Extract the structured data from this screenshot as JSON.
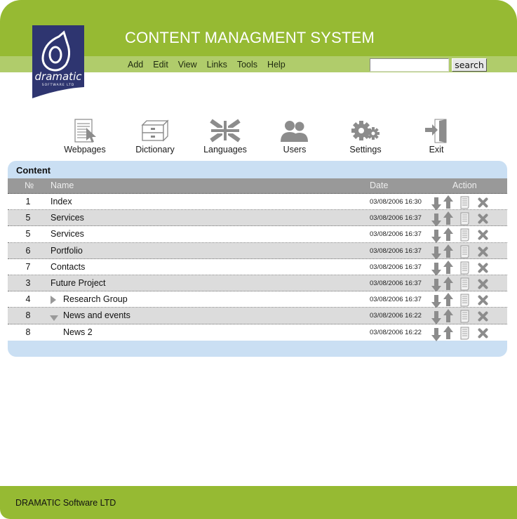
{
  "header": {
    "title": "CONTENT MANAGMENT SYSTEM",
    "logo": {
      "name": "dramatic",
      "tagline": "SOFTWARE LTD"
    },
    "menu": [
      "Add",
      "Edit",
      "View",
      "Links",
      "Tools",
      "Help"
    ],
    "search": {
      "value": "",
      "placeholder": "",
      "button_label": "search"
    }
  },
  "toolbar": [
    {
      "label": "Webpages",
      "icon": "webpage-icon"
    },
    {
      "label": "Dictionary",
      "icon": "dictionary-icon"
    },
    {
      "label": "Languages",
      "icon": "uk-flag-icon"
    },
    {
      "label": "Users",
      "icon": "users-icon"
    },
    {
      "label": "Settings",
      "icon": "gears-icon"
    },
    {
      "label": "Exit",
      "icon": "exit-door-icon"
    }
  ],
  "content": {
    "title": "Content",
    "columns": {
      "num": "№",
      "name": "Name",
      "date": "Date",
      "action": "Action"
    },
    "rows": [
      {
        "num": "1",
        "name": "Index",
        "date": "03/08/2006 16:30",
        "tree": "none"
      },
      {
        "num": "5",
        "name": "Services",
        "date": "03/08/2006 16:37",
        "tree": "none"
      },
      {
        "num": "5",
        "name": "Services",
        "date": "03/08/2006 16:37",
        "tree": "none"
      },
      {
        "num": "6",
        "name": "Portfolio",
        "date": "03/08/2006 16:37",
        "tree": "none"
      },
      {
        "num": "7",
        "name": "Contacts",
        "date": "03/08/2006 16:37",
        "tree": "none"
      },
      {
        "num": "3",
        "name": "Future Project",
        "date": "03/08/2006 16:37",
        "tree": "none"
      },
      {
        "num": "4",
        "name": "Research Group",
        "date": "03/08/2006 16:37",
        "tree": "collapsed"
      },
      {
        "num": "8",
        "name": "News and events",
        "date": "03/08/2006 16:22",
        "tree": "expanded"
      },
      {
        "num": "8",
        "name": "News 2",
        "date": "03/08/2006 16:22",
        "tree": "child"
      }
    ],
    "actions": [
      "move-down",
      "move-up",
      "edit-page",
      "delete"
    ]
  },
  "footer": {
    "text": "DRAMATIC Software LTD"
  },
  "colors": {
    "brand_green": "#96ba33",
    "menubar_green": "#b0cc6b",
    "logo_navy": "#2e3570",
    "panel_blue": "#cadff3",
    "header_gray": "#999999",
    "row_alt": "#dcdcdc",
    "icon_gray": "#8c8c8c"
  }
}
